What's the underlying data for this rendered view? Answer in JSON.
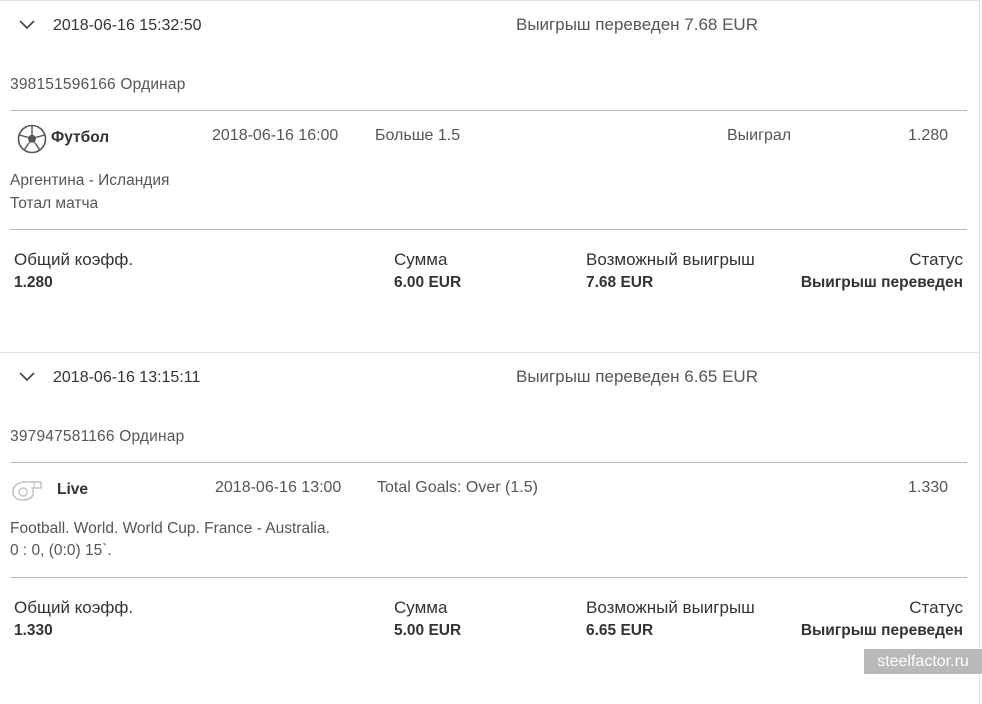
{
  "bets": [
    {
      "date": "2018-06-16 15:32:50",
      "status_line": "Выигрыш переведен 7.68 EUR",
      "ticket": "398151596166 Ординар",
      "selection": {
        "sport": "Футбол",
        "sport_icon": "soccer-ball-icon",
        "event_date": "2018-06-16 16:00",
        "market": "Больше 1.5",
        "result": "Выиграл",
        "odds": "1.280",
        "event_line1": "Аргентина - Исландия",
        "event_line2": "Тотал матча"
      },
      "summary": {
        "coef_label": "Общий коэфф.",
        "coef_value": "1.280",
        "amount_label": "Сумма",
        "amount_value": "6.00 EUR",
        "payout_label": "Возможный выигрыш",
        "payout_value": "7.68 EUR",
        "status_label": "Статус",
        "status_value": "Выигрыш переведен"
      }
    },
    {
      "date": "2018-06-16 13:15:11",
      "status_line": "Выигрыш переведен 6.65 EUR",
      "ticket": "397947581166 Ординар",
      "selection": {
        "sport": "Live",
        "sport_icon": "whistle-icon",
        "event_date": "2018-06-16 13:00",
        "market": "Total Goals: Over (1.5)",
        "result": "",
        "odds": "1.330",
        "event_line1": "Football. World. World Cup. France - Australia.",
        "event_line2": "0 : 0, (0:0) 15`."
      },
      "summary": {
        "coef_label": "Общий коэфф.",
        "coef_value": "1.330",
        "amount_label": "Сумма",
        "amount_value": "5.00 EUR",
        "payout_label": "Возможный выигрыш",
        "payout_value": "6.65 EUR",
        "status_label": "Статус",
        "status_value": "Выигрыш переведен"
      }
    }
  ],
  "watermark": "steelfactor.ru"
}
